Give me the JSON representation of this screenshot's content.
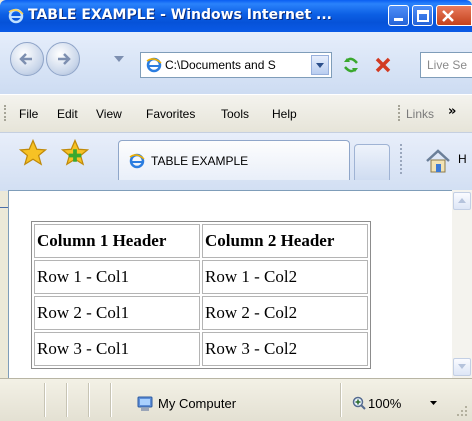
{
  "window": {
    "title": "TABLE EXAMPLE - Windows Internet ...",
    "title_bar_color": "#0a5ae6"
  },
  "address_bar": {
    "url": "C:\\Documents and S",
    "search_placeholder": "Live Se"
  },
  "menu": {
    "items": [
      "File",
      "Edit",
      "View",
      "Favorites",
      "Tools",
      "Help"
    ],
    "links_label": "Links",
    "overflow_label": "»"
  },
  "tabs": {
    "active_label": "TABLE EXAMPLE",
    "home_label": "H"
  },
  "page": {
    "headers": [
      "Column 1 Header",
      "Column 2 Header"
    ],
    "rows": [
      [
        "Row 1 - Col1",
        "Row 1 - Col2"
      ],
      [
        "Row 2 - Col1",
        "Row 2 - Col2"
      ],
      [
        "Row 3 - Col1",
        "Row 3 - Col2"
      ]
    ]
  },
  "status": {
    "zone_label": "My Computer",
    "zoom_label": "100%"
  },
  "icons": {
    "ie": "ie-icon",
    "back": "back-arrow-icon",
    "forward": "forward-arrow-icon",
    "refresh": "refresh-icon",
    "stop": "stop-icon",
    "favorites": "favorites-star-icon",
    "add_favorite": "add-favorite-icon",
    "home": "home-icon",
    "computer": "my-computer-icon",
    "zoom": "zoom-icon"
  }
}
